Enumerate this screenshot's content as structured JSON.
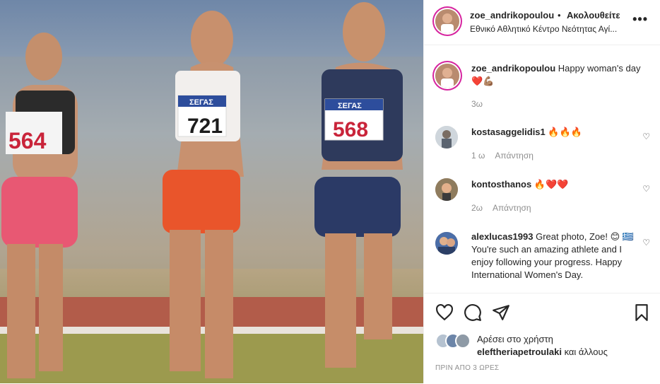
{
  "post": {
    "username": "zoe_andrikopoulou",
    "separator": "•",
    "follow_label": "Ακολουθείτε",
    "location": "Εθνικό Αθλητικό Κέντρο Νεότητας Αγί...",
    "more_icon": "more-horizontal-icon",
    "photo": {
      "bib_left": "564",
      "bib_center": "721",
      "bib_right": "568",
      "bib_brand": "ΣΕΓΑΣ"
    }
  },
  "caption": {
    "username": "zoe_andrikopoulou",
    "text": "Happy woman's day",
    "emoji": "❤️💪🏽",
    "time": "3ω"
  },
  "comments": [
    {
      "username": "kostasaggelidis1",
      "text": "🔥🔥🔥",
      "time": "1 ω",
      "reply": "Απάντηση"
    },
    {
      "username": "kontosthanos",
      "text": "🔥❤️❤️",
      "time": "2ω",
      "reply": "Απάντηση"
    },
    {
      "username": "alexlucas1993",
      "text": "Great photo, Zoe! 😊 🇬🇷 You're such an amazing athlete and I enjoy following your progress. Happy International Women's Day."
    }
  ],
  "likes": {
    "line1": "Αρέσει στο χρήστη",
    "user": "eleftheriapetroulaki",
    "and_others": "και άλλους"
  },
  "footer_time": "ΠΡΙΝ ΑΠΟ 3 ΩΡΕΣ",
  "colors": {
    "text": "#262626",
    "muted": "#8e8e8e",
    "border": "#efefef"
  }
}
